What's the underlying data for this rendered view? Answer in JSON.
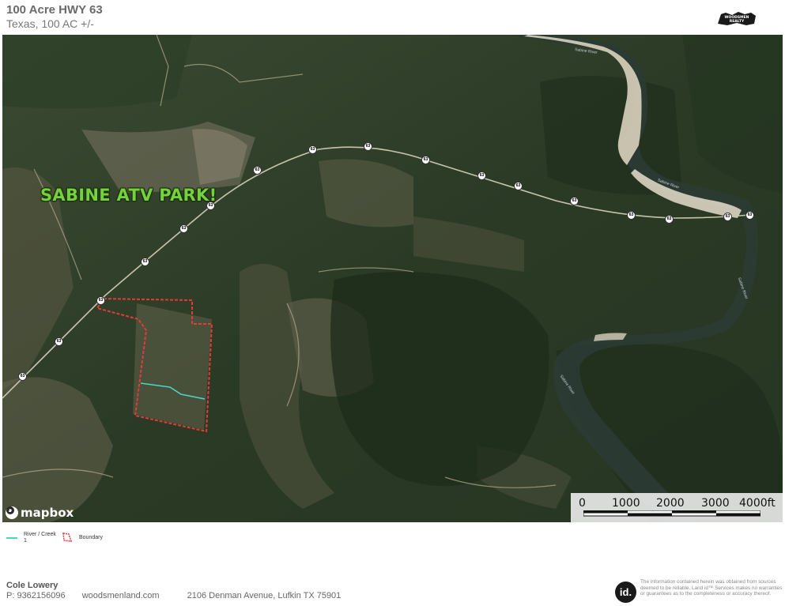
{
  "header": {
    "title": "100 Acre HWY 63",
    "subtitle": "Texas, 100 AC +/-",
    "logo_text": "WOODSMEN REALTY"
  },
  "map": {
    "annotation": "SABINE ATV PARK!",
    "attribution": "mapbox",
    "highway_shield": "63",
    "river_names": [
      "Sabine River",
      "Sabine River",
      "Sabine River",
      "Sabine River"
    ],
    "scale_labels": [
      "0",
      "1000",
      "2000",
      "3000",
      "4000ft"
    ],
    "colors": {
      "boundary": "#e23b3b",
      "creek": "#45d6c4",
      "atv_label": "#74d23a"
    }
  },
  "legend": {
    "items": [
      {
        "label": "River / Creek",
        "sublabel": "1",
        "icon": "line-icon"
      },
      {
        "label": "Boundary",
        "sublabel": "",
        "icon": "boundary-icon"
      }
    ]
  },
  "footer": {
    "agent_name": "Cole Lowery",
    "phone": "P: 9362156096",
    "website": "woodsmenland.com",
    "address": "2106 Denman Avenue, Lufkin TX 75901",
    "id_logo": "id.",
    "disclaimer": "The information contained herein was obtained from sources deemed to be reliable. Land id™ Services makes no warranties or guarantees as to the completeness or accuracy thereof."
  }
}
